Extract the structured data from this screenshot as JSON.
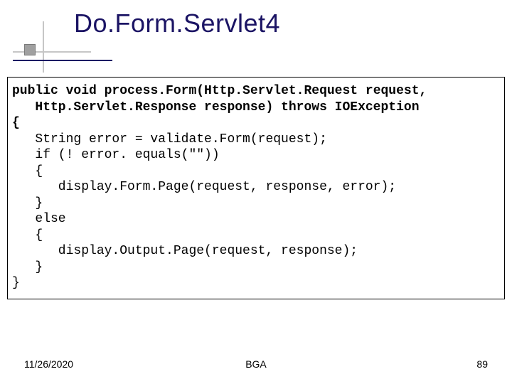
{
  "title": "Do.Form.Servlet4",
  "code_lines": [
    {
      "t": "public void",
      "b0": true,
      "t1": " process.Form(Http.Servlet.Request request,",
      "b1": true
    },
    {
      "t": "   Http.Servlet.Response response) ",
      "b0": true,
      "t1": "throws",
      "b1": true,
      "t2": " IOException",
      "b2": true
    },
    {
      "t": "{",
      "b0": true
    },
    {
      "t": "   String error = validate.Form(request);"
    },
    {
      "t": "   if (! error. equals(\"\"))"
    },
    {
      "t": "   {"
    },
    {
      "t": "      display.Form.Page(request, response, error);"
    },
    {
      "t": "   }"
    },
    {
      "t": "   else"
    },
    {
      "t": "   {"
    },
    {
      "t": "      display.Output.Page(request, response);"
    },
    {
      "t": "   }"
    },
    {
      "t": "}"
    }
  ],
  "code_plain": "public void process.Form(Http.Servlet.Request request,\n   Http.Servlet.Response response) throws IOException\n{\n   String error = validate.Form(request);\n   if (! error. equals(\"\"))\n   {\n      display.Form.Page(request, response, error);\n   }\n   else\n   {\n      display.Output.Page(request, response);\n   }\n}",
  "footer": {
    "date": "11/26/2020",
    "center": "BGA",
    "page": "89"
  }
}
